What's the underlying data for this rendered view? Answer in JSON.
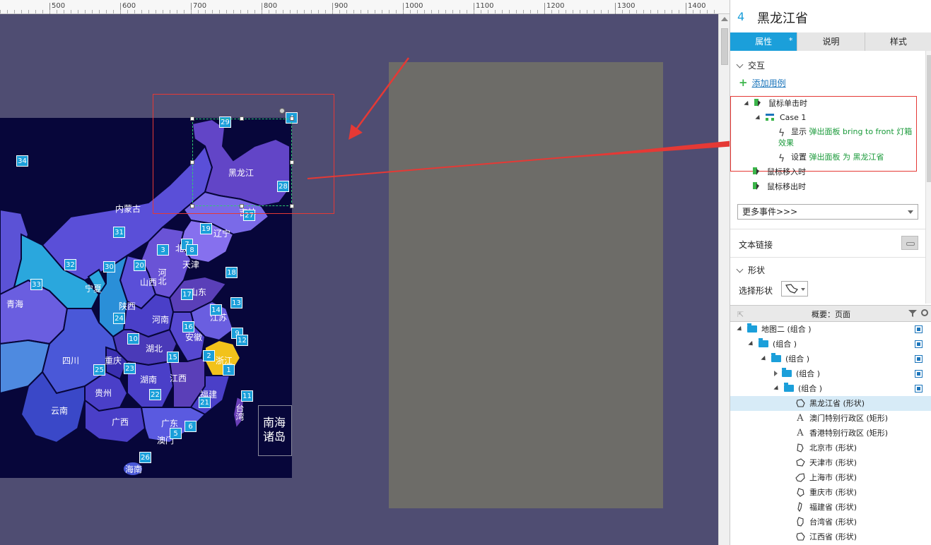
{
  "ruler": {
    "labels": [
      "500",
      "600",
      "700",
      "800",
      "900",
      "1000",
      "1100",
      "1200",
      "1300",
      "1400"
    ]
  },
  "map": {
    "provinces": [
      {
        "label": "黑龙江",
        "id": "heilongjiang"
      },
      {
        "label": "内蒙古",
        "id": "neimenggu"
      },
      {
        "label": "吉林",
        "id": "jilin"
      },
      {
        "label": "辽宁",
        "id": "liaoning"
      },
      {
        "label": "北京",
        "id": "beijing"
      },
      {
        "label": "天津",
        "id": "tianjin"
      },
      {
        "label": "河北",
        "id": "hebei"
      },
      {
        "label": "山西",
        "id": "shanxi"
      },
      {
        "label": "山东",
        "id": "shandong"
      },
      {
        "label": "宁夏",
        "id": "ningxia"
      },
      {
        "label": "青海",
        "id": "qinghai"
      },
      {
        "label": "陕西",
        "id": "shaanxi"
      },
      {
        "label": "河南",
        "id": "henan"
      },
      {
        "label": "江苏",
        "id": "jiangsu"
      },
      {
        "label": "安徽",
        "id": "anhui"
      },
      {
        "label": "湖北",
        "id": "hubei"
      },
      {
        "label": "四川",
        "id": "sichuan"
      },
      {
        "label": "重庆",
        "id": "chongqing"
      },
      {
        "label": "浙江",
        "id": "zhejiang"
      },
      {
        "label": "湖南",
        "id": "hunan"
      },
      {
        "label": "江西",
        "id": "jiangxi"
      },
      {
        "label": "贵州",
        "id": "guizhou"
      },
      {
        "label": "福建",
        "id": "fujian"
      },
      {
        "label": "台湾",
        "id": "taiwan"
      },
      {
        "label": "云南",
        "id": "yunnan"
      },
      {
        "label": "广西",
        "id": "guangxi"
      },
      {
        "label": "广东",
        "id": "guangdong"
      },
      {
        "label": "澳门",
        "id": "macau"
      },
      {
        "label": "海南",
        "id": "hainan"
      }
    ],
    "badges": [
      "29",
      "4",
      "34",
      "28",
      "27",
      "31",
      "19",
      "7",
      "3",
      "8",
      "32",
      "30",
      "20",
      "18",
      "33",
      "17",
      "13",
      "14",
      "24",
      "16",
      "9",
      "12",
      "10",
      "2",
      "15",
      "25",
      "23",
      "1",
      "22",
      "21",
      "11",
      "6",
      "5",
      "26"
    ],
    "nanhai_label": "南海诸岛"
  },
  "panel": {
    "widget_number": "4",
    "widget_name": "黑龙江省",
    "tabs": [
      {
        "label": "属性",
        "star": "*"
      },
      {
        "label": "说明"
      },
      {
        "label": "样式"
      }
    ],
    "interactions": {
      "section_title": "交互",
      "add_case": "添加用例",
      "on_click": "鼠标单击时",
      "case_name": "Case 1",
      "action1_verb": "显示",
      "action1_target": "弹出面板 bring to front 灯箱效果",
      "action2_verb": "设置",
      "action2_target": "弹出面板 为 黑龙江省",
      "on_mouse_enter": "鼠标移入时",
      "on_mouse_leave": "鼠标移出时",
      "more_events": "更多事件>>>"
    },
    "text_link": "文本链接",
    "shape_section": "形状",
    "select_shape": "选择形状"
  },
  "outline": {
    "title": "概要：页面",
    "rows": [
      {
        "label": "地图二 (组合 )",
        "type": "folder"
      },
      {
        "label": "(组合 )",
        "type": "folder"
      },
      {
        "label": "(组合 )",
        "type": "folder"
      },
      {
        "label": "(组合 )",
        "type": "folder-collapsed"
      },
      {
        "label": "(组合 )",
        "type": "folder"
      },
      {
        "label": "黑龙江省 (形状)",
        "type": "shape",
        "selected": true
      },
      {
        "label": "澳门特别行政区 (矩形)",
        "type": "text"
      },
      {
        "label": "香港特别行政区 (矩形)",
        "type": "text"
      },
      {
        "label": "北京市 (形状)",
        "type": "shape"
      },
      {
        "label": "天津市 (形状)",
        "type": "shape"
      },
      {
        "label": "上海市 (形状)",
        "type": "shape"
      },
      {
        "label": "重庆市 (形状)",
        "type": "shape"
      },
      {
        "label": "福建省 (形状)",
        "type": "shape"
      },
      {
        "label": "台湾省 (形状)",
        "type": "shape"
      },
      {
        "label": "江西省 (形状)",
        "type": "shape"
      }
    ]
  },
  "colors": {
    "accent": "#1b9fda",
    "canvas_bg": "#4f4d72",
    "map_bg": "#07063a",
    "highlight_red": "#e53935",
    "zhejiang_yellow": "#f2c21b",
    "action_green": "#1a9a3a"
  }
}
